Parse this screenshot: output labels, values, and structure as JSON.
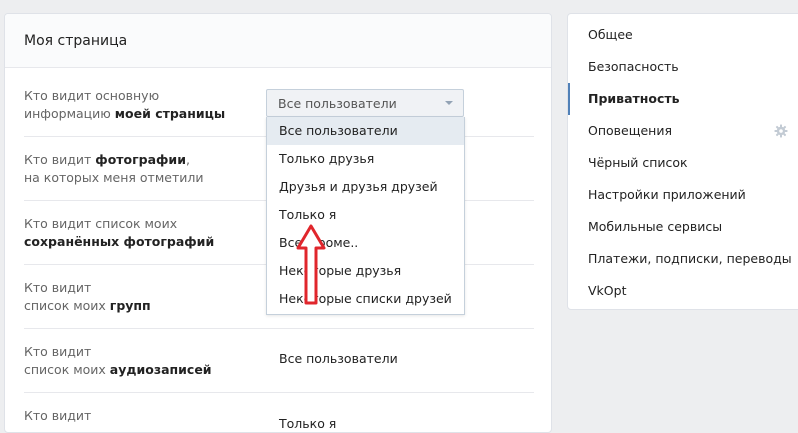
{
  "main": {
    "title": "Моя страница",
    "rows": [
      {
        "line1_plain": "Кто видит основную",
        "line2_plain": "информацию ",
        "line2_bold": "моей страницы"
      },
      {
        "line1_plain": "Кто видит ",
        "line1_bold": "фотографии",
        "line1_tail": ",",
        "line2_plain": "на которых меня отметили"
      },
      {
        "line1_plain": "Кто видит список моих",
        "line2_bold": "сохранённых фотографий"
      },
      {
        "line1_plain": "Кто видит",
        "line2_plain": "список моих ",
        "line2_bold": "групп"
      },
      {
        "line1_plain": "Кто видит",
        "line2_plain": "список моих ",
        "line2_bold": "аудиозаписей",
        "value": "Все пользователи"
      },
      {
        "line1_plain": "Кто видит",
        "value": "Только я"
      }
    ]
  },
  "select": {
    "current_value": "Все пользователи",
    "options": [
      "Все пользователи",
      "Только друзья",
      "Друзья и друзья друзей",
      "Только я",
      "Все, кроме..",
      "Некоторые друзья",
      "Некоторые списки друзей"
    ],
    "selected_index": 0
  },
  "sidebar": {
    "items": [
      "Общее",
      "Безопасность",
      "Приватность",
      "Оповещения",
      "Чёрный список",
      "Настройки приложений",
      "Мобильные сервисы",
      "Платежи, подписки, переводы",
      "VkOpt"
    ],
    "active_index": 2,
    "gear_on_index": 3
  },
  "colors": {
    "accent": "#5181b8",
    "annotation_arrow": "#e0262c",
    "background": "#edeef0"
  }
}
